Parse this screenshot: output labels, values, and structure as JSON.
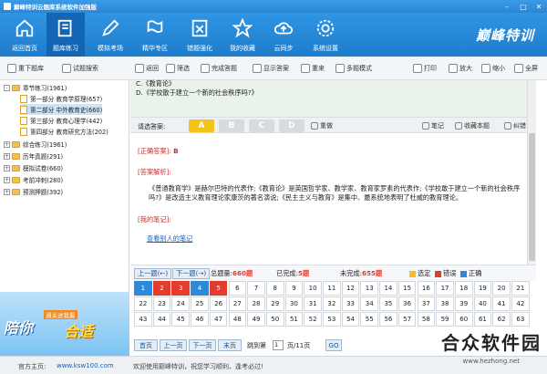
{
  "window": {
    "title": "巅峰特训云题库系统软件加强版"
  },
  "nav": {
    "items": [
      {
        "label": "返回首页",
        "icon": "home-icon"
      },
      {
        "label": "题库练习",
        "icon": "book-icon"
      },
      {
        "label": "模拟考场",
        "icon": "pen-icon"
      },
      {
        "label": "精华专区",
        "icon": "flag-icon"
      },
      {
        "label": "错题强化",
        "icon": "error-icon"
      },
      {
        "label": "我的收藏",
        "icon": "star-icon"
      },
      {
        "label": "云同步",
        "icon": "cloud-icon"
      },
      {
        "label": "系统设置",
        "icon": "gear-icon"
      }
    ],
    "active_index": 1,
    "brand": "巅峰特训"
  },
  "toolbar": {
    "reload": "重下题库",
    "search": "试题搜索",
    "back": "返回",
    "filter": "筛选",
    "finish": "完成答题",
    "show_answer": "显示答案",
    "redo": "重来",
    "multi": "多题模式",
    "print": "打印",
    "zoom_in": "放大",
    "zoom_out": "缩小",
    "fullscreen": "全屏"
  },
  "tree": {
    "nodes": [
      {
        "label": "章节练习(1961)"
      },
      {
        "label": "第一部分  教育学原理(657)"
      },
      {
        "label": "第二部分  中外教育史(660)"
      },
      {
        "label": "第三部分  教育心理学(442)"
      },
      {
        "label": "第四部分  教育研究方法(202)"
      },
      {
        "label": "综合练习(1961)"
      },
      {
        "label": "历年真题(291)"
      },
      {
        "label": "模拟试卷(660)"
      },
      {
        "label": "考前冲刺(280)"
      },
      {
        "label": "预测押题(392)"
      }
    ]
  },
  "ad": {
    "line1": "陪你",
    "tag": "通关",
    "tag2": "送我最",
    "line2": "合适"
  },
  "question": {
    "option_c": "C.《教育论》",
    "option_d": "D.《学校散于建立一个新的社会秩序吗?》"
  },
  "answer_bar": {
    "label": "请选答案:",
    "options": [
      "A",
      "B",
      "C",
      "D"
    ],
    "selected": "A",
    "redo": "重做",
    "note": "笔记",
    "favorite": "收藏本题",
    "correct": "纠错"
  },
  "result": {
    "correct_label": "[正确答案]:",
    "correct_value": "B",
    "analysis_label": "[答案解析]:",
    "analysis_text": "《普通教育学》是赫尔巴特的代表作;《教育论》是英国哲学家、教学家、教育家罗素的代表作;《学校敢于建立一个新的社会秩序吗?》是改造主义教育理论家康茨的著名演说;《民主主义与教育》是集中、最系统地表明了杜威的教育理论。",
    "notes_label": "[我的笔记]:",
    "others_notes": "查看别人的笔记"
  },
  "gridbar": {
    "prev": "上一题(←)",
    "next": "下一题(→)",
    "total_label": "总题量:",
    "total_value": "660题",
    "done_label": "已完成:",
    "done_value": "5题",
    "undone_label": "未完成:",
    "undone_value": "655题",
    "legend_selected": "选定",
    "legend_wrong": "错误",
    "legend_right": "正确"
  },
  "question_numbers": {
    "cells": [
      "1",
      "2",
      "3",
      "4",
      "5",
      "6",
      "7",
      "8",
      "9",
      "10",
      "11",
      "12",
      "13",
      "14",
      "15",
      "16",
      "17",
      "18",
      "19",
      "20",
      "21",
      "22",
      "23",
      "24",
      "25",
      "26",
      "27",
      "28",
      "29",
      "30",
      "31",
      "32",
      "33",
      "34",
      "35",
      "36",
      "37",
      "38",
      "39",
      "40",
      "41",
      "42",
      "43",
      "44",
      "45",
      "46",
      "47",
      "48",
      "49",
      "50",
      "51",
      "52",
      "53",
      "54",
      "55",
      "56",
      "57",
      "58",
      "59",
      "60",
      "61",
      "62",
      "63"
    ],
    "status": [
      "right",
      "wrong",
      "wrong",
      "right",
      "wrong"
    ]
  },
  "pager": {
    "first": "首页",
    "prev": "上一页",
    "next": "下一页",
    "last": "末页",
    "jump_label": "跳到第",
    "page_value": "1",
    "page_total": "页/11页",
    "go": "GO"
  },
  "status": {
    "home_label": "官方主页:",
    "home_url": "www.ksw100.com",
    "welcome": "欢迎使用巅峰特训，祝您学习顺利、逢考必过!"
  },
  "watermark": {
    "text": "合众软件园",
    "small": "www.hezhong.net"
  },
  "colors": {
    "nav": "#2b86d4",
    "selected": "#f2c318",
    "wrong": "#e13c2e",
    "right": "#2d8ad8"
  }
}
